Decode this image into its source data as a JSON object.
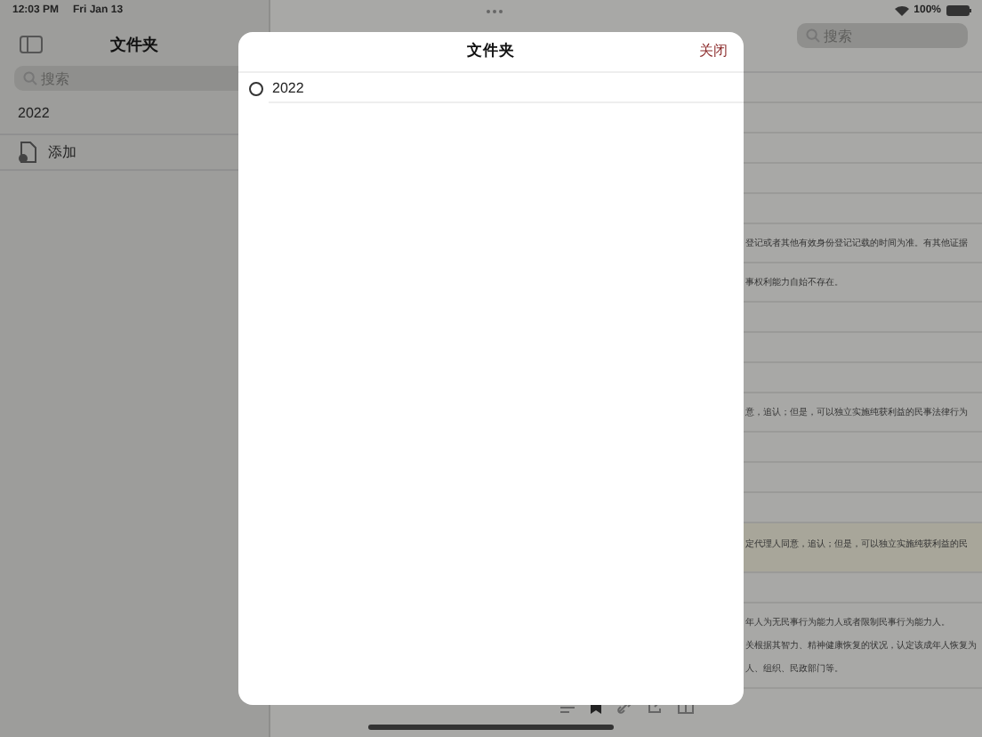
{
  "status_bar": {
    "time": "12:03 PM",
    "date": "Fri Jan 13",
    "battery": "100%"
  },
  "sidebar": {
    "title": "文件夹",
    "search": {
      "placeholder": "搜索"
    },
    "section": "2022",
    "items": [
      {
        "label": "添加"
      }
    ]
  },
  "content": {
    "search": {
      "placeholder": "搜索"
    },
    "rows": [
      {
        "kind": "blank"
      },
      {
        "kind": "blank"
      },
      {
        "kind": "blank"
      },
      {
        "kind": "blank"
      },
      {
        "kind": "blank"
      },
      {
        "kind": "text",
        "highlighted": false,
        "lines": [
          "登记或者其他有效身份登记记载的时间为准。有其他证据"
        ]
      },
      {
        "kind": "text",
        "highlighted": false,
        "lines": [
          "事权利能力自始不存在。"
        ]
      },
      {
        "kind": "blank"
      },
      {
        "kind": "blank"
      },
      {
        "kind": "blank"
      },
      {
        "kind": "text",
        "highlighted": false,
        "lines": [
          "意，追认；但是，可以独立实施纯获利益的民事法律行为"
        ]
      },
      {
        "kind": "blank"
      },
      {
        "kind": "blank"
      },
      {
        "kind": "blank"
      },
      {
        "kind": "text",
        "highlighted": true,
        "lines": [
          "定代理人同意，追认；但是，可以独立实施纯获利益的民"
        ]
      },
      {
        "kind": "blank"
      },
      {
        "kind": "text",
        "highlighted": false,
        "lines": [
          "年人为无民事行为能力人或者限制民事行为能力人。",
          "关根据其智力、精神健康恢复的状况，认定该成年人恢复为",
          "人、组织、民政部门等。"
        ]
      }
    ]
  },
  "modal": {
    "title": "文件夹",
    "close": "关闭",
    "folders": [
      {
        "name": "2022",
        "selected": false
      }
    ]
  }
}
